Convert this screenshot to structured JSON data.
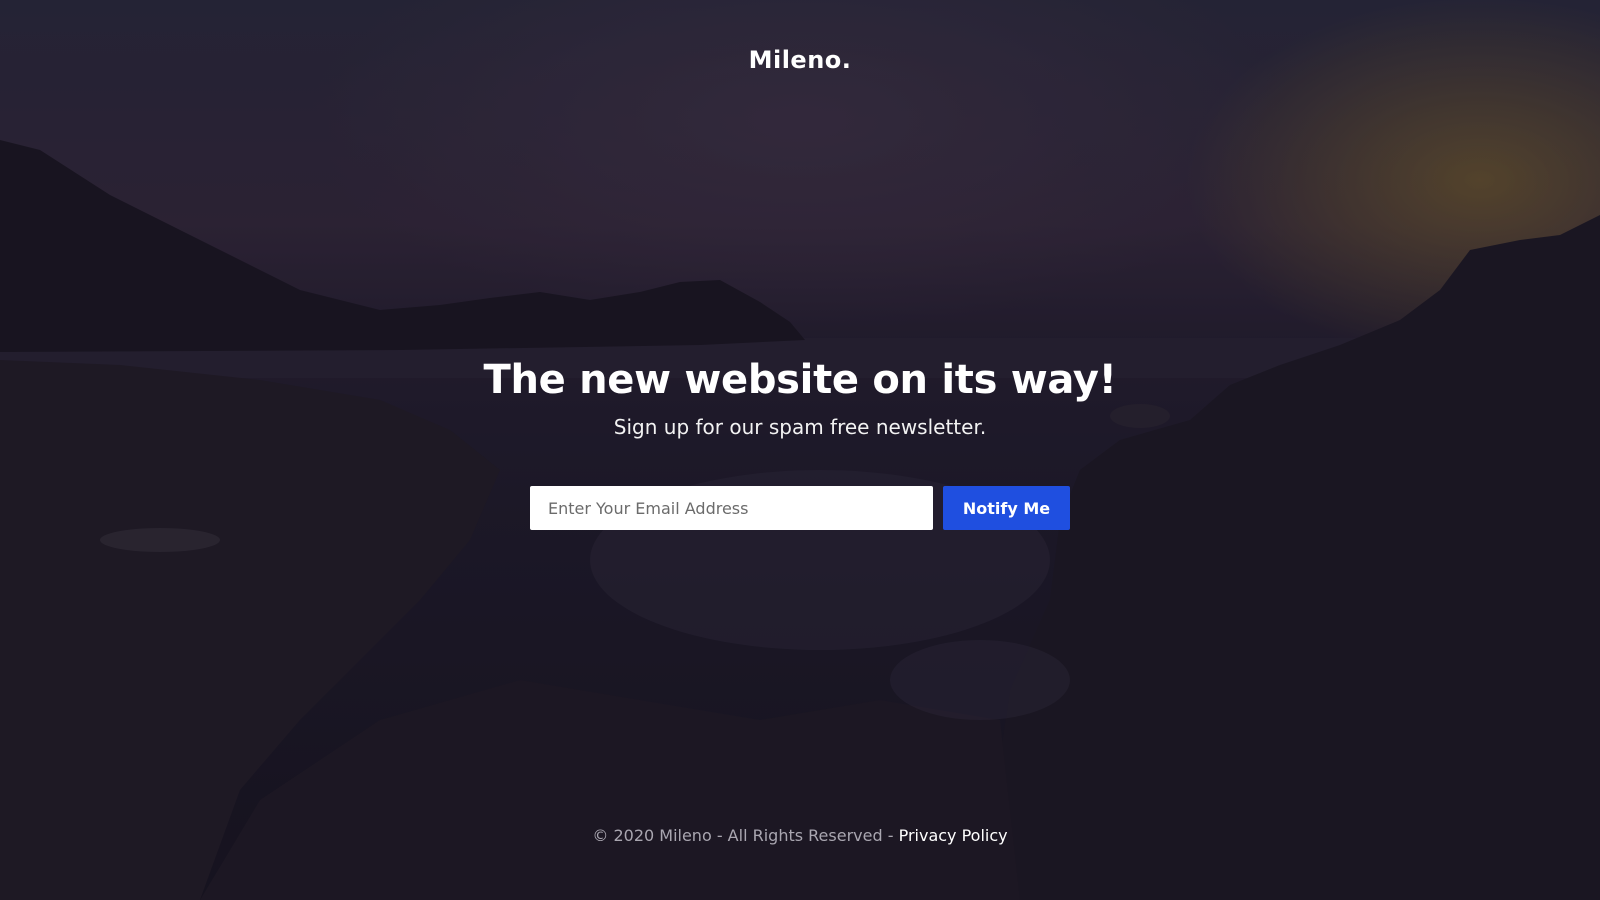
{
  "header": {
    "logo": "Mileno."
  },
  "hero": {
    "title": "The new website on its way!",
    "subtitle": "Sign up for our spam free newsletter."
  },
  "signup": {
    "email_placeholder": "Enter Your Email Address",
    "email_value": "",
    "button_label": "Notify Me"
  },
  "footer": {
    "copyright": "© 2020 Mileno - All Rights Reserved - ",
    "privacy_link": "Privacy Policy"
  },
  "colors": {
    "accent": "#1f4fe0",
    "text": "#ffffff",
    "footer_text": "#a9a6b0"
  }
}
